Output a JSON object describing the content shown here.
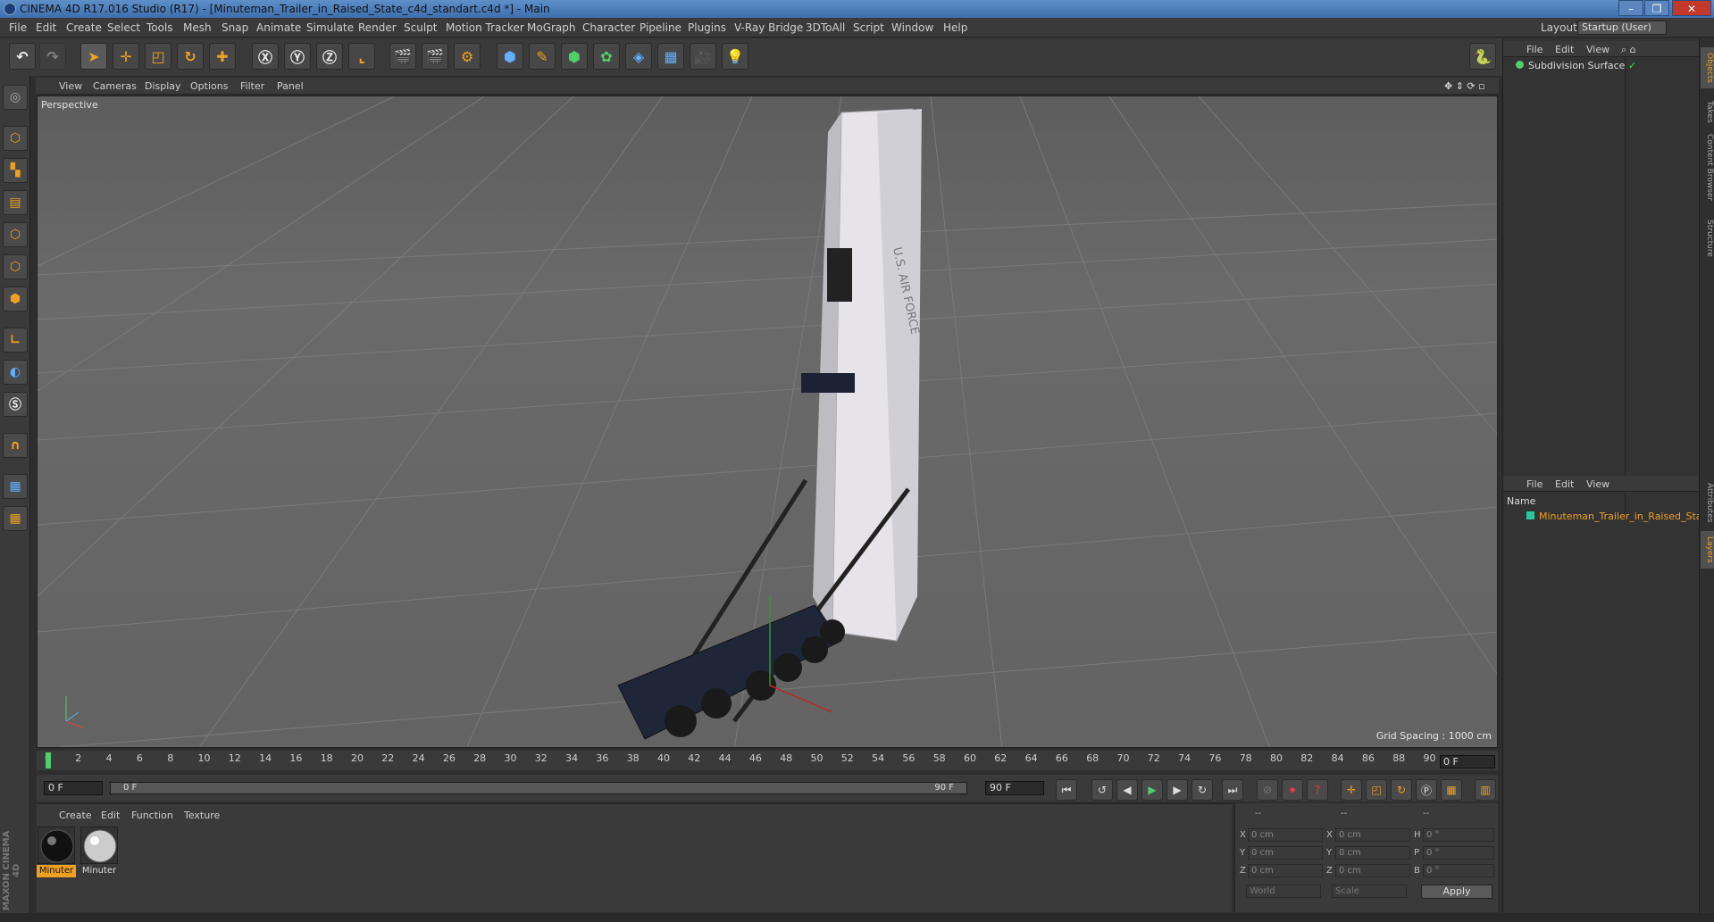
{
  "window": {
    "title": "CINEMA 4D R17.016 Studio (R17) - [Minuteman_Trailer_in_Raised_State_c4d_standart.c4d *] - Main",
    "controls": [
      "–",
      "❐",
      "✕"
    ]
  },
  "menubar": {
    "items": [
      "File",
      "Edit",
      "Create",
      "Select",
      "Tools",
      "Mesh",
      "Snap",
      "Animate",
      "Simulate",
      "Render",
      "Sculpt",
      "Motion Tracker",
      "MoGraph",
      "Character",
      "Pipeline",
      "Plugins",
      "V-Ray Bridge",
      "3DToAll",
      "Script",
      "Window",
      "Help"
    ],
    "layout_label": "Layout:",
    "layout_value": "Startup (User)"
  },
  "viewport": {
    "menu": [
      "View",
      "Cameras",
      "Display",
      "Options",
      "Filter",
      "Panel"
    ],
    "label": "Perspective",
    "grid_spacing": "Grid Spacing : 1000 cm",
    "model_text": "U.S. AIR FORCE"
  },
  "timeline": {
    "ticks": [
      "0",
      "2",
      "4",
      "6",
      "8",
      "10",
      "12",
      "14",
      "16",
      "18",
      "20",
      "22",
      "24",
      "26",
      "28",
      "30",
      "32",
      "34",
      "36",
      "38",
      "40",
      "42",
      "44",
      "46",
      "48",
      "50",
      "52",
      "54",
      "56",
      "58",
      "60",
      "62",
      "64",
      "66",
      "68",
      "70",
      "72",
      "74",
      "76",
      "78",
      "80",
      "82",
      "84",
      "86",
      "88",
      "90"
    ],
    "current_frame": "0 F"
  },
  "transport": {
    "start_field": "0 F",
    "slider_left": "0 F",
    "slider_right": "90 F",
    "end_field": "90 F"
  },
  "materials": {
    "menu": [
      "Create",
      "Edit",
      "Function",
      "Texture"
    ],
    "items": [
      {
        "name": "Minuter"
      },
      {
        "name": "Minuter"
      }
    ],
    "accent": "#f0a020"
  },
  "coordinates": {
    "headers": [
      "--",
      "--",
      "--"
    ],
    "rows": [
      {
        "a": "X",
        "av": "0 cm",
        "b": "X",
        "bv": "0 cm",
        "c": "H",
        "cv": "0 °"
      },
      {
        "a": "Y",
        "av": "0 cm",
        "b": "Y",
        "bv": "0 cm",
        "c": "P",
        "cv": "0 °"
      },
      {
        "a": "Z",
        "av": "0 cm",
        "b": "Z",
        "bv": "0 cm",
        "c": "B",
        "cv": "0 °"
      }
    ],
    "mode1": "World",
    "mode2": "Scale",
    "apply": "Apply"
  },
  "objects_panel": {
    "menu": [
      "File",
      "Edit",
      "View"
    ],
    "items": [
      {
        "name": "Subdivision Surface"
      }
    ]
  },
  "layers_panel": {
    "menu": [
      "File",
      "Edit",
      "View"
    ],
    "column": "Name",
    "items": [
      {
        "name": "Minuteman_Trailer_in_Raised_State"
      }
    ]
  },
  "side_tabs": [
    "Objects",
    "Takes",
    "Content Browser",
    "Structure",
    "Attributes",
    "Layers"
  ],
  "brand": "MAXON CINEMA 4D"
}
